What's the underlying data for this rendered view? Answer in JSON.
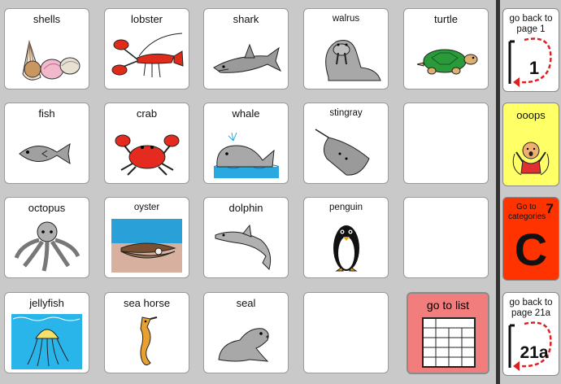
{
  "cells": [
    {
      "label": "shells"
    },
    {
      "label": "lobster"
    },
    {
      "label": "shark"
    },
    {
      "label": "walrus"
    },
    {
      "label": "turtle"
    },
    {
      "label": "fish"
    },
    {
      "label": "crab"
    },
    {
      "label": "whale"
    },
    {
      "label": "stingray"
    },
    {
      "label": "octopus"
    },
    {
      "label": "oyster"
    },
    {
      "label": "dolphin"
    },
    {
      "label": "penguin"
    },
    {
      "label": "jellyfish"
    },
    {
      "label": "sea horse"
    },
    {
      "label": "seal"
    }
  ],
  "go_to_list": {
    "label": "go to list"
  },
  "sidebar": {
    "back_page_1": {
      "label_line1": "go back to",
      "label_line2": "page 1",
      "page": "1"
    },
    "ooops": {
      "label": "ooops"
    },
    "categories": {
      "label_line1": "Go to",
      "label_line2": "categories",
      "number": "7",
      "letter": "C"
    },
    "back_page_21a": {
      "label_line1": "go back to",
      "label_line2": "page 21a",
      "page": "21a"
    }
  },
  "colors": {
    "background": "#c9c9c9",
    "ooops_bg": "#ffff66",
    "categories_bg": "#ff3300",
    "go_to_list_bg": "#f27d7d",
    "arrow_red": "#e02020"
  }
}
